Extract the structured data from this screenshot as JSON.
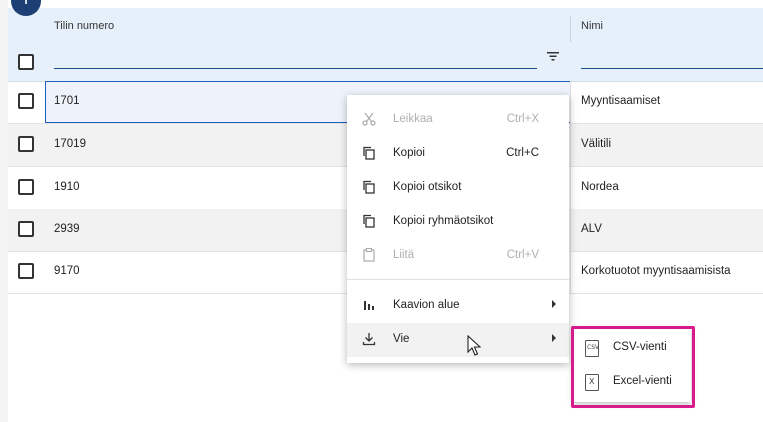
{
  "grid": {
    "columns": [
      {
        "label": "Tilin numero"
      },
      {
        "label": "Nimi"
      }
    ],
    "rows": [
      {
        "number": "1701",
        "name": "Myyntisaamiset"
      },
      {
        "number": "17019",
        "name": "Välitili"
      },
      {
        "number": "1910",
        "name": "Nordea"
      },
      {
        "number": "2939",
        "name": "ALV"
      },
      {
        "number": "9170",
        "name": "Korkotuotot myyntisaamisista"
      }
    ]
  },
  "add_button": {
    "label": "+"
  },
  "context_menu": {
    "items": [
      {
        "label": "Leikkaa",
        "shortcut": "Ctrl+X",
        "icon": "scissors-icon",
        "disabled": true
      },
      {
        "label": "Kopioi",
        "shortcut": "Ctrl+C",
        "icon": "copy-icon",
        "disabled": false
      },
      {
        "label": "Kopioi otsikot",
        "shortcut": "",
        "icon": "copy-icon",
        "disabled": false
      },
      {
        "label": "Kopioi ryhmäotsikot",
        "shortcut": "",
        "icon": "copy-icon",
        "disabled": false
      },
      {
        "label": "Liitä",
        "shortcut": "Ctrl+V",
        "icon": "clipboard-icon",
        "disabled": true
      },
      {
        "label": "Kaavion alue",
        "shortcut": "",
        "icon": "bar-chart-icon",
        "disabled": false
      },
      {
        "label": "Vie",
        "shortcut": "",
        "icon": "download-icon",
        "disabled": false
      }
    ]
  },
  "export_submenu": {
    "items": [
      {
        "label": "CSV-vienti",
        "icon_text": "CSV"
      },
      {
        "label": "Excel-vienti",
        "icon_text": "X"
      }
    ]
  },
  "colors": {
    "highlight": "#d81b8c",
    "header_bg": "#e6f0fa",
    "accent": "#1e3f73"
  }
}
